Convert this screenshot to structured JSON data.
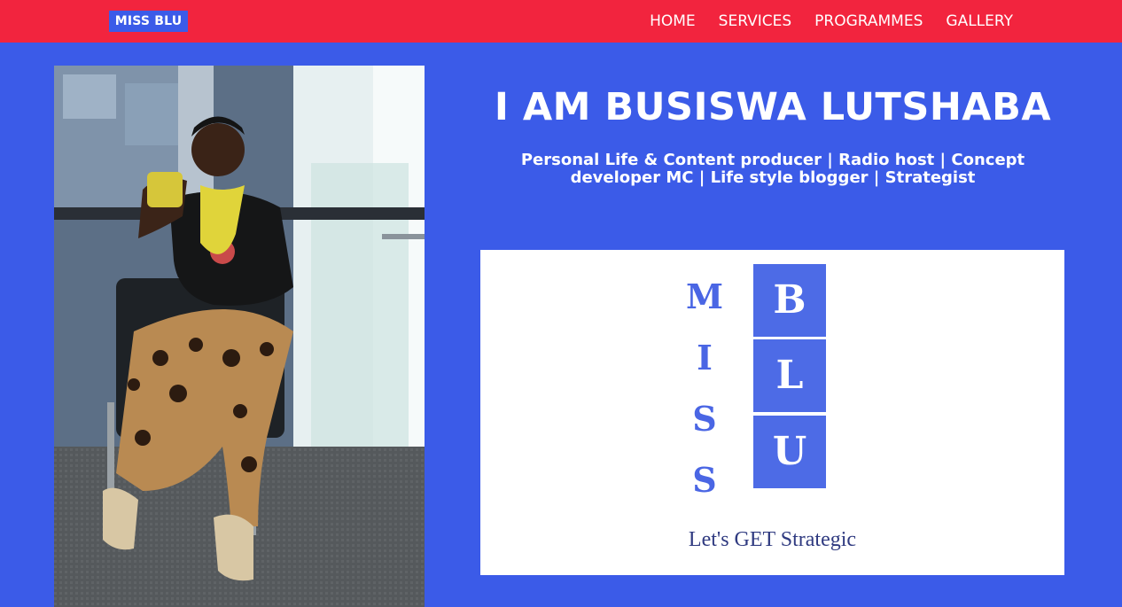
{
  "brand": {
    "logo_text": "MISS BLU"
  },
  "nav": {
    "items": [
      "HOME",
      "SERVICES",
      "PROGRAMMES",
      "GALLERY"
    ]
  },
  "hero": {
    "heading": "I AM BUSISWA LUTSHABA",
    "subtitle": "Personal Life & Content producer | Radio host | Concept developer MC | Life style blogger | Strategist"
  },
  "logo_card": {
    "miss_letters": [
      "M",
      "I",
      "S",
      "S"
    ],
    "blu_letters": [
      "B",
      "L",
      "U"
    ],
    "tagline": "Let's GET Strategic"
  },
  "colors": {
    "background": "#3b5be8",
    "topbar": "#f2243e",
    "logo_accent": "#4d6be6"
  }
}
